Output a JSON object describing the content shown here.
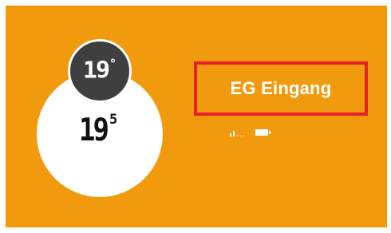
{
  "device": {
    "name": "EG Eingang",
    "target_temperature": "19",
    "target_unit": "°",
    "current_temperature_int": "19",
    "current_temperature_decimal": "5",
    "signal_icon": "signal-strength-icon",
    "signal_bars_active": 2,
    "signal_bars_total": 5,
    "battery_icon": "battery-icon",
    "battery_level": 1.0
  },
  "colors": {
    "card_background": "#f29a0e",
    "dial_background": "#ffffff",
    "target_bubble": "#3f3f3f",
    "highlight_border": "#e8202c",
    "text_on_card": "#ffffff",
    "current_text": "#111111"
  }
}
